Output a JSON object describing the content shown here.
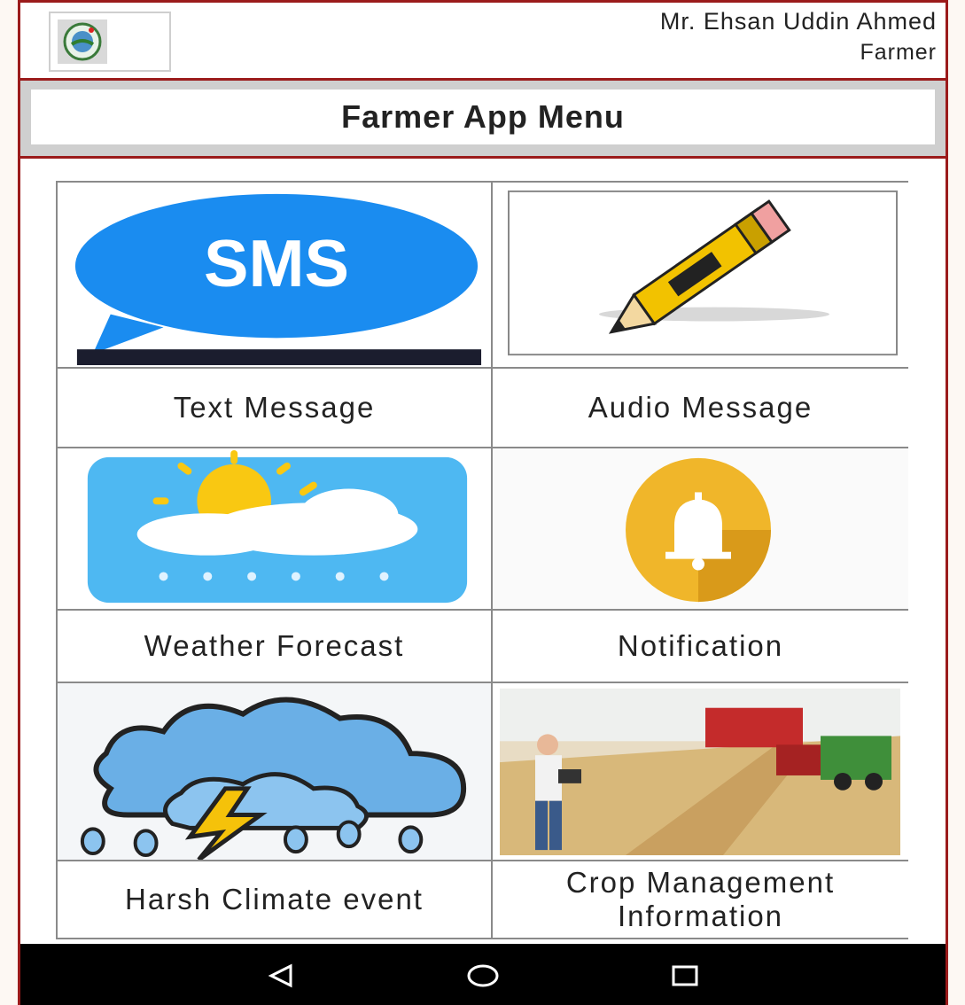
{
  "header": {
    "user_name": "Mr. Ehsan Uddin Ahmed",
    "user_role": "Farmer",
    "logo_icon": "organization-seal-logo"
  },
  "title": "Farmer App Menu",
  "menu": [
    {
      "label": "Text Message",
      "icon": "sms-bubble-icon",
      "image_text": "SMS"
    },
    {
      "label": "Audio Message",
      "icon": "pencil-icon"
    },
    {
      "label": "Weather Forecast",
      "icon": "weather-sun-cloud-icon"
    },
    {
      "label": "Notification",
      "icon": "bell-icon"
    },
    {
      "label": "Harsh Climate event",
      "icon": "storm-cloud-icon"
    },
    {
      "label": "Crop Management Information",
      "icon": "farm-harvest-photo"
    }
  ],
  "navbar": {
    "back_icon": "back-triangle-icon",
    "home_icon": "home-circle-icon",
    "recents_icon": "recents-square-icon"
  }
}
